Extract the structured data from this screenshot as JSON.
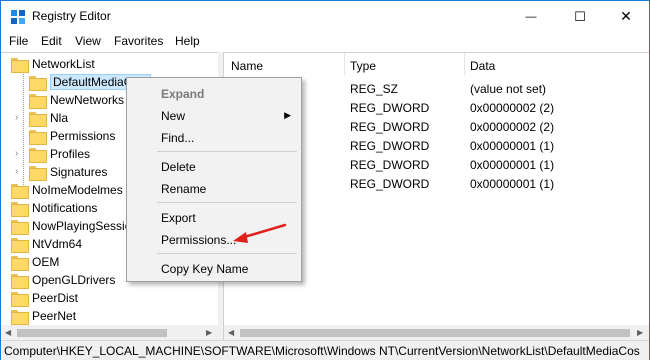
{
  "window": {
    "title": "Registry Editor",
    "minimize_glyph": "—",
    "maximize_glyph": "☐",
    "close_glyph": "✕"
  },
  "menu": [
    "File",
    "Edit",
    "View",
    "Favorites",
    "Help"
  ],
  "tree": {
    "items": [
      {
        "label": "NetworkList"
      },
      {
        "label": "DefaultMediaCost"
      },
      {
        "label": "NewNetworks"
      },
      {
        "label": "Nla"
      },
      {
        "label": "Permissions"
      },
      {
        "label": "Profiles"
      },
      {
        "label": "Signatures"
      },
      {
        "label": "NoImeModelmes"
      },
      {
        "label": "Notifications"
      },
      {
        "label": "NowPlayingSession"
      },
      {
        "label": "NtVdm64"
      },
      {
        "label": "OEM"
      },
      {
        "label": "OpenGLDrivers"
      },
      {
        "label": "PeerDist"
      },
      {
        "label": "PeerNet"
      }
    ]
  },
  "list": {
    "headers": {
      "name": "Name",
      "type": "Type",
      "data": "Data"
    },
    "rows": [
      {
        "type": "REG_SZ",
        "data": "(value not set)"
      },
      {
        "type": "REG_DWORD",
        "data": "0x00000002 (2)"
      },
      {
        "type": "REG_DWORD",
        "data": "0x00000002 (2)"
      },
      {
        "type": "REG_DWORD",
        "data": "0x00000001 (1)"
      },
      {
        "type": "REG_DWORD",
        "data": "0x00000001 (1)"
      },
      {
        "type": "REG_DWORD",
        "data": "0x00000001 (1)"
      }
    ]
  },
  "context_menu": {
    "expand": "Expand",
    "new": "New",
    "find": "Find...",
    "delete": "Delete",
    "rename": "Rename",
    "export": "Export",
    "permissions": "Permissions...",
    "copy_key_name": "Copy Key Name"
  },
  "status": {
    "path": "Computer\\HKEY_LOCAL_MACHINE\\SOFTWARE\\Microsoft\\Windows NT\\CurrentVersion\\NetworkList\\DefaultMediaCos"
  },
  "colors": {
    "accent": "#1b7ad8",
    "selection": "#cce8ff",
    "annotation_arrow": "#e0201c",
    "folder": "#ffd967"
  },
  "icons": {
    "app": "registry-editor-icon",
    "folder": "folder-icon",
    "submenu": "chevron-right-icon",
    "annotation": "red-arrow-icon"
  }
}
